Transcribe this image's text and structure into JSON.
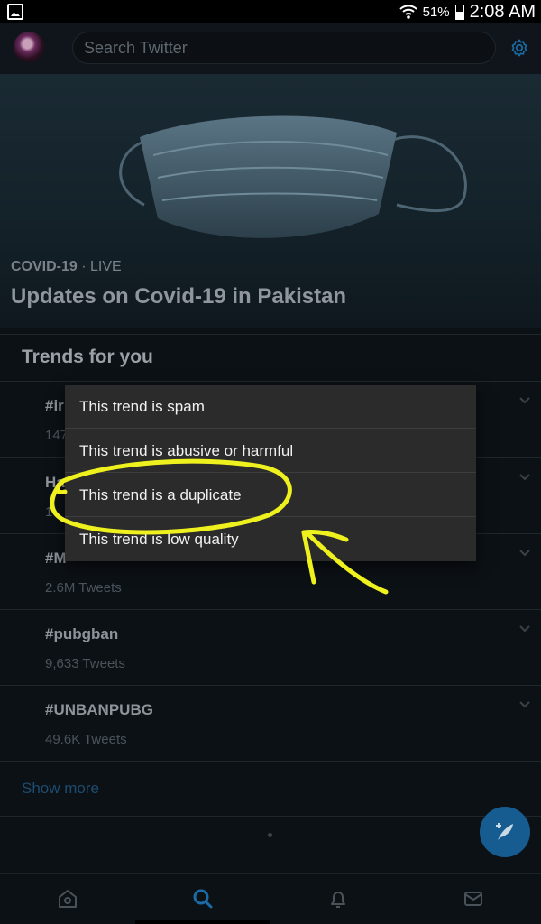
{
  "status_bar": {
    "battery_percent": "51%",
    "time": "2:08 AM"
  },
  "search": {
    "placeholder": "Search Twitter"
  },
  "hero": {
    "category": "COVID-19",
    "separator": " · ",
    "live_label": "LIVE",
    "title": "Updates on Covid-19 in Pakistan"
  },
  "trends": {
    "heading": "Trends for you",
    "items": [
      {
        "name": "#ir",
        "count": "147"
      },
      {
        "name": "Ha",
        "count": "1"
      },
      {
        "name": "#M",
        "count": "2.6M Tweets"
      },
      {
        "name": "#pubgban",
        "count": "9,633 Tweets"
      },
      {
        "name": "#UNBANPUBG",
        "count": "49.6K Tweets"
      }
    ],
    "show_more": "Show more"
  },
  "context_menu": {
    "items": [
      "This trend is spam",
      "This trend is abusive or harmful",
      "This trend is a duplicate",
      "This trend is low quality"
    ]
  },
  "colors": {
    "accent": "#1da1f2",
    "annotation": "#f5f01e",
    "background": "#0c1116",
    "menu_bg": "#2b2b2b"
  },
  "bottom_nav": [
    "home-icon",
    "search-icon",
    "notifications-icon",
    "messages-icon"
  ]
}
